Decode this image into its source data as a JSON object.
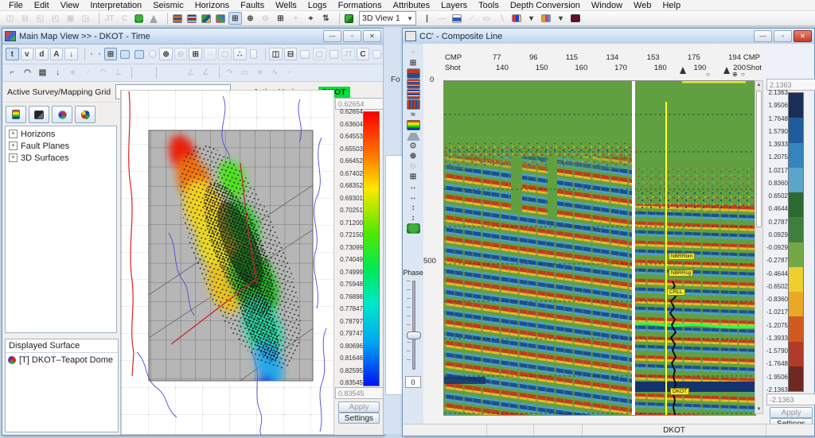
{
  "menu": {
    "items": [
      "File",
      "Edit",
      "View",
      "Interpretation",
      "Seismic",
      "Horizons",
      "Faults",
      "Wells",
      "Logs",
      "Formations",
      "Attributes",
      "Layers",
      "Tools",
      "Depth Conversion",
      "Window",
      "Web",
      "Help"
    ]
  },
  "main_toolbar": {
    "view_selector": "3D View 1",
    "icons": [
      {
        "name": "tile-horizontal-icon",
        "glyph": "◫",
        "disabled": true
      },
      {
        "name": "tile-vertical-icon",
        "glyph": "⊟",
        "disabled": true
      },
      {
        "name": "cascade-windows-icon",
        "glyph": "◱",
        "disabled": true
      },
      {
        "name": "arrange-windows-icon",
        "glyph": "◰",
        "disabled": true
      },
      {
        "name": "restore-windows-icon",
        "glyph": "▣",
        "disabled": true
      },
      {
        "name": "minimize-all-icon",
        "glyph": "◲",
        "disabled": true
      },
      {
        "sep": true
      },
      {
        "name": "jt-tool-icon",
        "glyph": "JT",
        "disabled": true
      },
      {
        "name": "c-tool-icon",
        "glyph": "C",
        "disabled": true
      },
      {
        "name": "bug-icon",
        "cls": "bug"
      },
      {
        "name": "flask-icon",
        "cls": "flask"
      },
      {
        "sep": true
      },
      {
        "name": "seismic-view-icon",
        "cls": "seisA",
        "pressed": true
      },
      {
        "name": "arbitrary-line-view-icon",
        "cls": "seisB",
        "pressed": true
      },
      {
        "name": "map-view-icon",
        "cls": "mapA",
        "pressed": true
      },
      {
        "name": "base-map-view-icon",
        "cls": "mapB",
        "pressed": true
      },
      {
        "name": "tile-views-icon",
        "glyph": "⊞",
        "pressed": true
      },
      {
        "name": "zoom-in-icon",
        "glyph": "⊕"
      },
      {
        "name": "zoom-out-icon",
        "glyph": "⊖",
        "disabled": true
      },
      {
        "name": "zoom-all-icon",
        "glyph": "⊞"
      },
      {
        "name": "pan-icon",
        "glyph": "+",
        "disabled": true
      },
      {
        "name": "find-well-icon",
        "glyph": "⌖"
      },
      {
        "name": "sort-wells-icon",
        "glyph": "⇅"
      },
      {
        "sep": true
      },
      {
        "name": "3d-cube-icon",
        "cls": "cube"
      }
    ],
    "icons2": [
      {
        "name": "cursor-line-icon",
        "glyph": "|"
      },
      {
        "name": "horizontal-tool-icon",
        "glyph": "—",
        "disabled": true
      },
      {
        "name": "log-template-icon",
        "cls": "bluebar"
      },
      {
        "name": "slash-tool-icon",
        "glyph": "∕",
        "disabled": true
      },
      {
        "name": "rectangle-tool-icon",
        "glyph": "▭",
        "disabled": true
      },
      {
        "name": "backslash-tool-icon",
        "glyph": "∖",
        "disabled": true
      },
      {
        "name": "fault-color-set-icon",
        "cls": "flagA"
      },
      {
        "name": "fault-color-dropdown-icon",
        "glyph": "▾"
      },
      {
        "name": "horizon-color-set-icon",
        "cls": "flagB"
      },
      {
        "name": "horizon-color-dropdown-icon",
        "glyph": "▾"
      },
      {
        "name": "active-color-swatch",
        "cls": "maroon"
      }
    ]
  },
  "map_window": {
    "title": "Main Map View >>  - DKOT - Time",
    "toolbar1": [
      {
        "name": "time-domain-button",
        "glyph": "t",
        "pressed": true
      },
      {
        "name": "velocity-domain-button",
        "glyph": "v"
      },
      {
        "name": "depth-domain-button",
        "glyph": "d"
      },
      {
        "name": "amplitude-button",
        "glyph": "A"
      },
      {
        "name": "down-arrow-button",
        "glyph": "↓"
      },
      {
        "sep": true
      },
      {
        "name": "horizon-pick-icon",
        "cls": "pickA",
        "pressed": true
      },
      {
        "name": "fault-pick-icon",
        "cls": "pickB",
        "pressed": true
      },
      {
        "name": "grid-display-icon",
        "glyph": "⊞",
        "pressed": true
      },
      {
        "name": "fault-display-icon",
        "cls": "seisB",
        "pressed": true
      },
      {
        "name": "surface-display-icon",
        "cls": "mapA",
        "pressed": true
      },
      {
        "name": "bead-icon",
        "cls": "bead"
      },
      {
        "name": "zoom-in-icon",
        "glyph": "⊕"
      },
      {
        "name": "zoom-out-icon",
        "glyph": "⊖",
        "disabled": true
      },
      {
        "name": "zoom-window-icon",
        "glyph": "⊞"
      },
      {
        "name": "pan-hand-icon",
        "glyph": "○",
        "disabled": true
      },
      {
        "name": "report-icon",
        "glyph": "▢",
        "disabled": true
      },
      {
        "name": "posted-data-icon",
        "glyph": "∴"
      },
      {
        "name": "color-scale-icon",
        "cls": "rainbow"
      },
      {
        "sep": true
      },
      {
        "name": "split-vertical-icon",
        "glyph": "◫"
      },
      {
        "name": "split-horizontal-icon",
        "glyph": "⊟"
      },
      {
        "name": "histogram-icon",
        "cls": "bluebar"
      },
      {
        "name": "blank-button-icon",
        "glyph": "▢",
        "disabled": true
      },
      {
        "name": "snapshot-icon",
        "cls": "greenimg"
      },
      {
        "name": "jt-icon",
        "glyph": "JT",
        "disabled": true
      },
      {
        "name": "c-icon",
        "glyph": "C"
      },
      {
        "name": "bug-icon",
        "cls": "bug"
      }
    ],
    "toolbar2": [
      {
        "name": "select-polygon-icon",
        "glyph": "⌐"
      },
      {
        "name": "select-curve-icon",
        "glyph": "◠"
      },
      {
        "name": "list-icon",
        "glyph": "▤"
      },
      {
        "name": "import-icon",
        "glyph": "↓"
      },
      {
        "name": "star-icon",
        "glyph": "∗",
        "disabled": true
      },
      {
        "name": "line-draw-icon",
        "glyph": "∕",
        "disabled": true
      },
      {
        "name": "arc-draw-icon",
        "glyph": "◠",
        "disabled": true
      },
      {
        "name": "perpendicular-icon",
        "glyph": "⊥",
        "disabled": true
      },
      {
        "sep": true
      },
      {
        "name": "pick-horizon-icon",
        "cls": "pickA"
      },
      {
        "name": "pick-fault-icon",
        "cls": "pickB"
      },
      {
        "sep": true
      },
      {
        "name": "fault-segment-icon",
        "cls": "pickC"
      },
      {
        "name": "fault-segment2-icon",
        "cls": "pickC"
      },
      {
        "name": "fault-segment3-icon",
        "cls": "pickB"
      },
      {
        "name": "angle-icon",
        "glyph": "∠",
        "disabled": true
      },
      {
        "name": "angle2-icon",
        "glyph": "∠",
        "disabled": true
      },
      {
        "sep": true
      },
      {
        "name": "redo-icon",
        "glyph": "↷",
        "disabled": true
      },
      {
        "name": "select-rect-icon",
        "glyph": "▭",
        "disabled": true
      },
      {
        "name": "snap-icon",
        "glyph": "∗",
        "disabled": true
      },
      {
        "name": "spline-icon",
        "glyph": "∿",
        "disabled": true
      },
      {
        "name": "trend-icon",
        "glyph": "⌐",
        "disabled": true
      }
    ],
    "controls": {
      "survey_label": "Active Survey/Mapping Grid",
      "survey_value": "",
      "horizon_label": "Active Horizon",
      "horizon_value": "DKOT",
      "horizon_chip_color": "#00e03c"
    },
    "side_toolbar": [
      {
        "name": "contour-display-icon",
        "cls": "rainbow"
      },
      {
        "name": "shadow-display-icon",
        "cls": "dark"
      },
      {
        "name": "surface-pie-icon",
        "cls": "pie",
        "pressed": true
      },
      {
        "name": "mesh-display-icon",
        "cls": "pieB"
      }
    ],
    "tree": {
      "items": [
        "Horizons",
        "Fault Planes",
        "3D Surfaces"
      ]
    },
    "displayed_surface": {
      "header": "Displayed Surface",
      "items": [
        {
          "label": "[T] DKOT–Teapot Dome"
        }
      ]
    },
    "color_scale": {
      "top_value": "0.62654",
      "bottom_value": "0.83545",
      "ticks": [
        "0.62654",
        "0.63604",
        "0.64553",
        "0.65503",
        "0.66452",
        "0.67402",
        "0.68352",
        "0.69301",
        "0.70251",
        "0.71200",
        "0.72150",
        "0.73099",
        "0.74049",
        "0.74999",
        "0.75948",
        "0.76898",
        "0.77847",
        "0.78797",
        "0.79747",
        "0.80696",
        "0.81646",
        "0.82595",
        "0.83545"
      ],
      "gradient_colors": [
        "#fa0000",
        "#ff7a00",
        "#ffe800",
        "#52e800",
        "#00e85a",
        "#00e8c8",
        "#00a8f0",
        "#0014f0"
      ],
      "apply_label": "Apply",
      "settings_label": "Settings"
    }
  },
  "background_window": {
    "partial_text": "Fo"
  },
  "seismic_window": {
    "title": "CC' - Composite Line",
    "left_toolbar": {
      "icons": [
        {
          "name": "select-icon",
          "glyph": "+",
          "disabled": true
        },
        {
          "name": "zoom-window-icon",
          "glyph": "⊞"
        },
        {
          "name": "tx-display-icon",
          "cls": "seisFX"
        },
        {
          "name": "color-display-icon",
          "cls": "seisA"
        },
        {
          "name": "wiggle-display-icon",
          "cls": "seisB"
        },
        {
          "name": "color-wiggle-display-icon",
          "cls": "seisC"
        },
        {
          "name": "wavelet-icon",
          "glyph": "≈"
        },
        {
          "name": "color-scale-icon",
          "cls": "rainbow"
        },
        {
          "name": "flatten-icon",
          "cls": "flask"
        },
        {
          "name": "picker-icon",
          "glyph": "⊙"
        },
        {
          "name": "zoom-in-icon",
          "glyph": "⊕"
        },
        {
          "name": "zoom-out-icon",
          "glyph": "⊖",
          "disabled": true
        },
        {
          "name": "fit-icon",
          "glyph": "⊞"
        },
        {
          "name": "stretch-horizontal-icon",
          "glyph": "↔"
        },
        {
          "name": "shrink-horizontal-icon",
          "glyph": "↔"
        },
        {
          "name": "stretch-vertical-icon",
          "glyph": "↕"
        },
        {
          "name": "shrink-vertical-icon",
          "glyph": "↕"
        },
        {
          "name": "bug-icon",
          "cls": "bug"
        }
      ],
      "phase_label": "Phase",
      "phase_value": "0"
    },
    "axes": {
      "cmp_label": "CMP",
      "shot_label": "Shot",
      "cmp_values": [
        "77",
        "96",
        "115",
        "134",
        "153",
        "175",
        "194"
      ],
      "shot_values": [
        "140",
        "150",
        "160",
        "170",
        "180",
        "190",
        "200"
      ],
      "time_ticks": [
        "0",
        "500"
      ]
    },
    "annotations": {
      "formation_labels": [
        "NBRRbm",
        "NBRRsg",
        "CRLL",
        "DKOT"
      ],
      "horizon_pick_color": "#2bff50",
      "well_track_color": "#ffff29"
    },
    "color_scale": {
      "top_value": "2.1363",
      "bottom_value": "-2.1363",
      "ticks": [
        "2.1363",
        "1.9506",
        "1.7648",
        "1.5790",
        "1.3933",
        "1.2075",
        "1.0217",
        "0.8360",
        "0.6502",
        "0.4644",
        "0.2787",
        "0.0929",
        "-0.0929",
        "-0.2787",
        "-0.4644",
        "-0.6502",
        "-0.8360",
        "-1.0217",
        "-1.2075",
        "-1.3933",
        "-1.5790",
        "-1.7648",
        "-1.9506",
        "-2.1363"
      ],
      "blocks": [
        "#1b2e5a",
        "#1e5c9e",
        "#3484bd",
        "#5aa5c9",
        "#2d6a33",
        "#3f7f3c",
        "#74a846",
        "#edd02f",
        "#e9a825",
        "#d2591f",
        "#b03b27",
        "#6e2a20"
      ],
      "apply_label": "Apply",
      "settings_label": "Settings"
    },
    "status_bar": {
      "text": "DKOT"
    }
  }
}
